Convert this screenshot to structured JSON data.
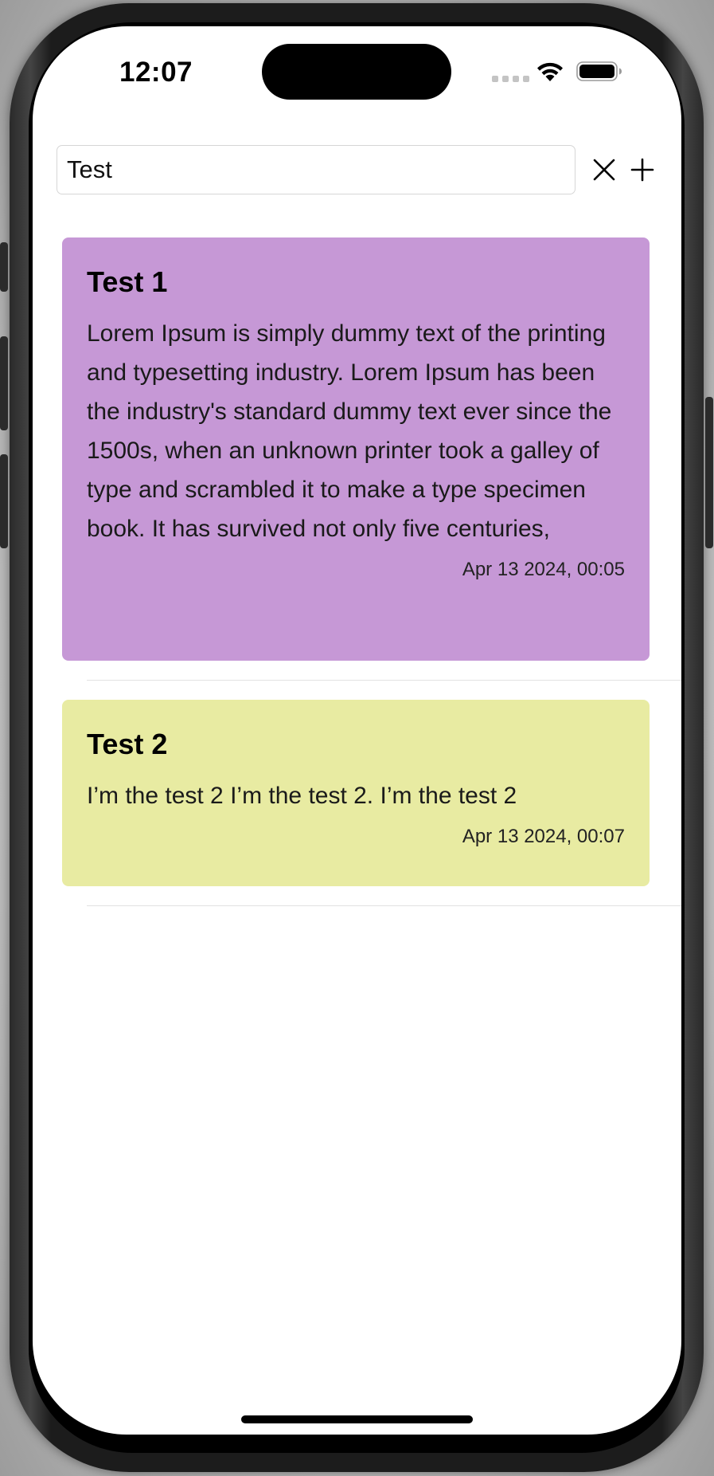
{
  "status_bar": {
    "time": "12:07"
  },
  "search": {
    "value": "Test",
    "clear_icon": "close-icon",
    "add_icon": "plus-icon"
  },
  "notes": [
    {
      "title": "Test 1",
      "body": "Lorem Ipsum is simply dummy text of the printing and typesetting industry. Lorem Ipsum has been the industry's standard dummy text ever since the 1500s, when an unknown printer took a galley of type and scrambled it to make a type specimen book. It has survived not only five centuries,",
      "date": "Apr 13 2024, 00:05",
      "color": "#C698D6"
    },
    {
      "title": "Test 2",
      "body": "I’m the test 2 I’m the test 2. I’m the test 2",
      "date": "Apr 13 2024, 00:07",
      "color": "#E8EBA2"
    }
  ]
}
